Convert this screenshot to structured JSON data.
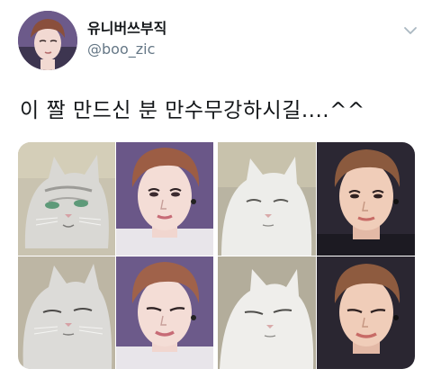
{
  "tweet": {
    "display_name": "유니버쓰부직",
    "handle": "@boo_zic",
    "text": "이 짤 만드신 분 만수무강하시길....^^"
  },
  "icons": {
    "menu": "chevron-down-icon"
  },
  "colors": {
    "text_primary": "#14171a",
    "text_secondary": "#657786",
    "chevron": "#aab8c2"
  }
}
